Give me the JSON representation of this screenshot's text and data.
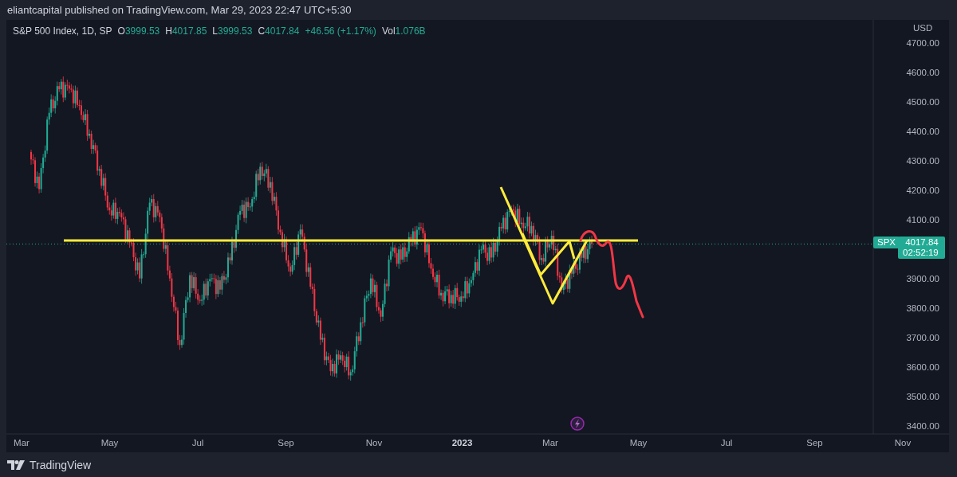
{
  "header": {
    "attribution": "eliantcapital published on TradingView.com, Mar 29, 2023 22:47 UTC+5:30"
  },
  "legend": {
    "title": "S&P 500 Index, 1D, SP",
    "fields": [
      {
        "label": "O",
        "value": "3999.53"
      },
      {
        "label": "H",
        "value": "4017.85"
      },
      {
        "label": "L",
        "value": "3999.53"
      },
      {
        "label": "C",
        "value": "4017.84"
      }
    ],
    "change": "+46.56 (+1.17%)",
    "volume": {
      "label": "Vol",
      "value": "1.076B"
    }
  },
  "price_axis": {
    "currency": "USD",
    "ticks": [
      "4700.00",
      "4600.00",
      "4500.00",
      "4400.00",
      "4300.00",
      "4200.00",
      "4100.00",
      "3900.00",
      "3800.00",
      "3700.00",
      "3600.00",
      "3500.00",
      "3400.00"
    ]
  },
  "time_axis": {
    "labels": [
      {
        "text": "Mar",
        "kind": "month"
      },
      {
        "text": "May",
        "kind": "month"
      },
      {
        "text": "Jul",
        "kind": "month"
      },
      {
        "text": "Sep",
        "kind": "month"
      },
      {
        "text": "Nov",
        "kind": "month"
      },
      {
        "text": "2023",
        "kind": "year"
      },
      {
        "text": "Mar",
        "kind": "month"
      },
      {
        "text": "May",
        "kind": "month"
      },
      {
        "text": "Jul",
        "kind": "month"
      },
      {
        "text": "Sep",
        "kind": "month"
      },
      {
        "text": "Nov",
        "kind": "month"
      }
    ]
  },
  "last_price": {
    "symbol": "SPX",
    "price": "4017.84",
    "countdown": "02:52:19"
  },
  "footer": {
    "brand": "TradingView"
  }
}
